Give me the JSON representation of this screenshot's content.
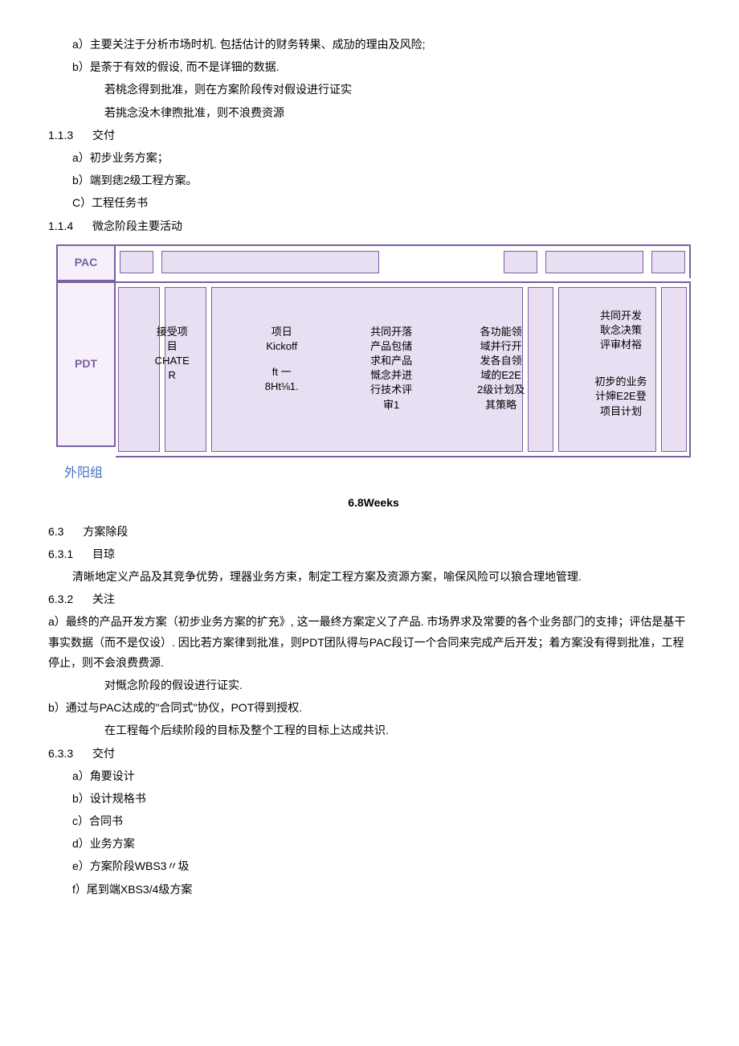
{
  "items": {
    "a1": "a）主要关注于分析市场时机. 包括估计的财务转果、成劢的理由及风险;",
    "b1": "b）是荼于有效的假设, 而不是详钿的数据.",
    "sub1": "若桃念得到批准，则在方案阶段传对假设进行证实",
    "sub2": "若挑念没木律煦批准，则不浪费资源"
  },
  "sec113": {
    "num": "1.1.3",
    "title": "交付",
    "a": "a）初步业务方案；",
    "b": "b）端到痣2级工程方案。",
    "c": "C）工程任务书"
  },
  "sec114": {
    "num": "1.1.4",
    "title": "微念阶段主要活动"
  },
  "diagram": {
    "pac_label": "PAC",
    "pdt_label": "PDT",
    "outgroup": "外阳组",
    "weeks": "6.8Weeks",
    "act1": "接受项\n目\nCHATE\nR",
    "act2": "项日\nKickoff",
    "act2_sub": "ft 一\n8Ht⅛1.",
    "act3": "共同开落\n产品包储\n求和产品\n慨念并进\n行技术评\n审1",
    "act4": "各功能领\n域并行开\n发各自领\n域的E2E\n2级计划及\n其策略",
    "act5": "共同开发\n耿念决策\n评审材裕",
    "act5_sub": "初步的业务\n计婶E2E登\n项目计划"
  },
  "sec63": {
    "num": "6.3",
    "title": "方案除段"
  },
  "sec631": {
    "num": "6.3.1",
    "title": "目琼",
    "text": "清晰地定义产品及其竞争优势，理器业务方束，制定工程方案及资源方案，喻保风险可以狼合理地管理."
  },
  "sec632": {
    "num": "6.3.2",
    "title": "关注",
    "a": "a）最终的产品开发方案（初步业务方案的扩充》, 这一最终方案定义了产品. 市场界求及常要的各个业务部门的支排；评估是基干事实数据（而不是仅设）. 因比若方案律到批准，则PDT团队得与PAC段订一个合同来完成产后开发；着方案没有得到批准，工程停止，则不会浪费费源.",
    "a_sub": "对慨念阶段的假设进行证实.",
    "b": "b）通过与PAC达成的\"合同式\"协仪，POT得到授权.",
    "b_sub": "在工程每个后续阶段的目标及整个工程的目标上达成共识."
  },
  "sec633": {
    "num": "6.3.3",
    "title": "交付",
    "a": "a）角要设计",
    "b": "b）设计规格书",
    "c": "c）合同书",
    "d": "d）业务方案",
    "e": "e）方案阶段WBS3〃圾",
    "f": "f）尾到端XBS3/4级方案"
  }
}
